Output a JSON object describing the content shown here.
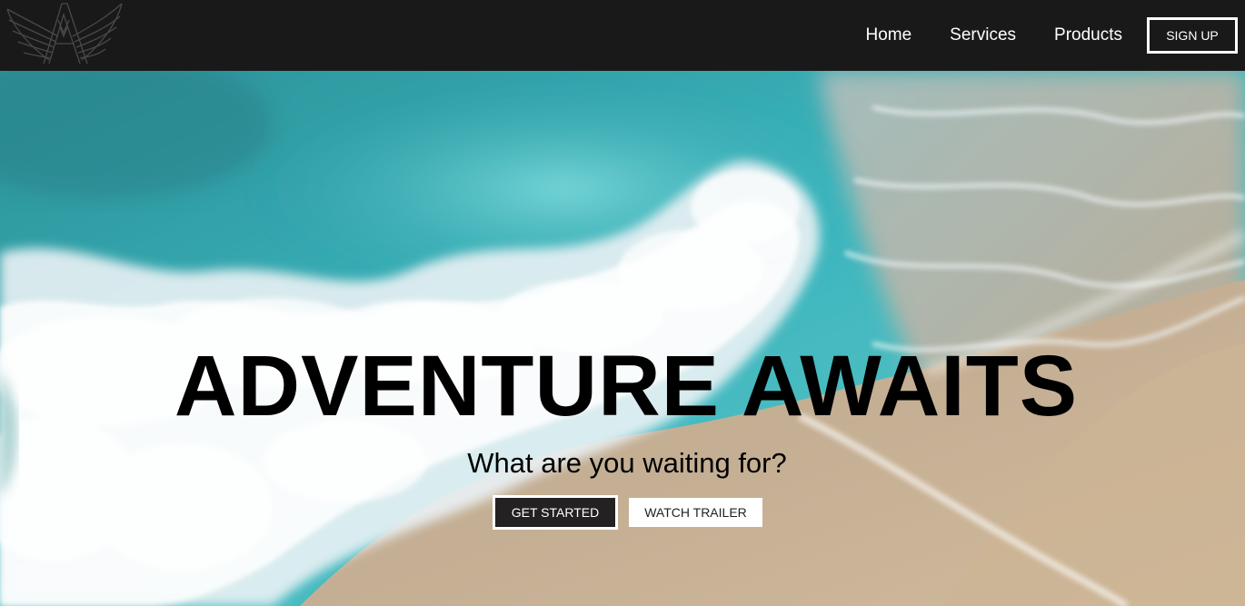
{
  "colors": {
    "navbar_bg": "#1a1919",
    "nav_text": "#ffffff",
    "hero_title": "#000000",
    "primary_button_bg": "#232121",
    "secondary_button_bg": "#ffffff"
  },
  "navbar": {
    "logo_icon": "winged-a-logo-icon",
    "links": [
      "Home",
      "Services",
      "Products"
    ],
    "signup_label": "SIGN UP"
  },
  "hero": {
    "background": "ocean-wave-beach-aerial",
    "title": "ADVENTURE AWAITS",
    "subtitle": "What are you waiting for?",
    "primary_button": "GET STARTED",
    "secondary_button": "WATCH TRAILER"
  }
}
